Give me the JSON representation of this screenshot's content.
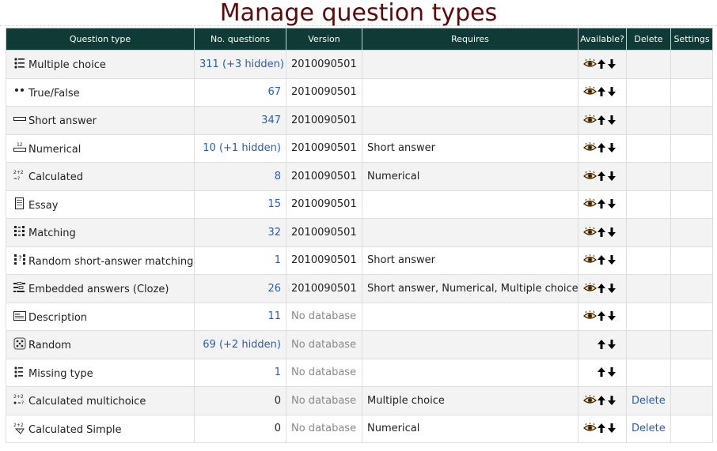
{
  "page_title": "Manage question types",
  "columns": [
    "Question type",
    "No. questions",
    "Version",
    "Requires",
    "Available?",
    "Delete",
    "Settings"
  ],
  "rows": [
    {
      "icon": "multichoice-icon",
      "name": "Multiple choice",
      "count": "311 (+3 hidden)",
      "count_link": true,
      "version": "2010090501",
      "version_nodb": false,
      "requires": "",
      "visible": true,
      "delete": ""
    },
    {
      "icon": "truefalse-icon",
      "name": "True/False",
      "count": "67",
      "count_link": true,
      "version": "2010090501",
      "version_nodb": false,
      "requires": "",
      "visible": true,
      "delete": ""
    },
    {
      "icon": "shortanswer-icon",
      "name": "Short answer",
      "count": "347",
      "count_link": true,
      "version": "2010090501",
      "version_nodb": false,
      "requires": "",
      "visible": true,
      "delete": ""
    },
    {
      "icon": "numerical-icon",
      "name": "Numerical",
      "count": "10 (+1 hidden)",
      "count_link": true,
      "version": "2010090501",
      "version_nodb": false,
      "requires": "Short answer",
      "visible": true,
      "delete": ""
    },
    {
      "icon": "calculated-icon",
      "name": "Calculated",
      "count": "8",
      "count_link": true,
      "version": "2010090501",
      "version_nodb": false,
      "requires": "Numerical",
      "visible": true,
      "delete": ""
    },
    {
      "icon": "essay-icon",
      "name": "Essay",
      "count": "15",
      "count_link": true,
      "version": "2010090501",
      "version_nodb": false,
      "requires": "",
      "visible": true,
      "delete": ""
    },
    {
      "icon": "matching-icon",
      "name": "Matching",
      "count": "32",
      "count_link": true,
      "version": "2010090501",
      "version_nodb": false,
      "requires": "",
      "visible": true,
      "delete": ""
    },
    {
      "icon": "randomsamatch-icon",
      "name": "Random short-answer matching",
      "count": "1",
      "count_link": true,
      "version": "2010090501",
      "version_nodb": false,
      "requires": "Short answer",
      "visible": true,
      "delete": ""
    },
    {
      "icon": "cloze-icon",
      "name": "Embedded answers (Cloze)",
      "count": "26",
      "count_link": true,
      "version": "2010090501",
      "version_nodb": false,
      "requires": "Short answer, Numerical, Multiple choice",
      "visible": true,
      "delete": ""
    },
    {
      "icon": "description-icon",
      "name": "Description",
      "count": "11",
      "count_link": true,
      "version": "No database",
      "version_nodb": true,
      "requires": "",
      "visible": true,
      "delete": ""
    },
    {
      "icon": "random-dice-icon",
      "name": "Random",
      "count": "69 (+2 hidden)",
      "count_link": true,
      "version": "No database",
      "version_nodb": true,
      "requires": "",
      "visible": false,
      "delete": ""
    },
    {
      "icon": "missingtype-icon",
      "name": "Missing type",
      "count": "1",
      "count_link": true,
      "version": "No database",
      "version_nodb": true,
      "requires": "",
      "visible": false,
      "delete": ""
    },
    {
      "icon": "calculatedmulti-icon",
      "name": "Calculated multichoice",
      "count": "0",
      "count_link": false,
      "version": "No database",
      "version_nodb": true,
      "requires": "Multiple choice",
      "visible": true,
      "delete": "Delete"
    },
    {
      "icon": "calculatedsimple-icon",
      "name": "Calculated Simple",
      "count": "0",
      "count_link": false,
      "version": "No database",
      "version_nodb": true,
      "requires": "Numerical",
      "visible": true,
      "delete": "Delete"
    }
  ],
  "colors": {
    "header_bg": "#0f3a35",
    "title": "#5a0a0a",
    "link": "#2a5db0"
  }
}
